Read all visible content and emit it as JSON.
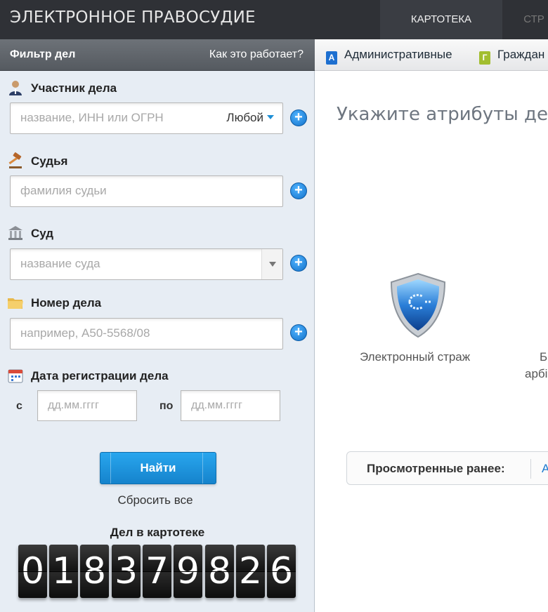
{
  "header": {
    "brand": "ЭЛЕКТРОННОЕ ПРАВОСУДИЕ",
    "tabs": [
      {
        "label": "КАРТОТЕКА",
        "active": true
      },
      {
        "label": "СТР"
      }
    ]
  },
  "filter": {
    "title": "Фильтр дел",
    "how_it_works": "Как это работает?",
    "participant": {
      "label": "Участник дела",
      "placeholder": "название, ИНН или ОГРН",
      "mode": "Любой"
    },
    "judge": {
      "label": "Судья",
      "placeholder": "фамилия судьи"
    },
    "court": {
      "label": "Суд",
      "placeholder": "название суда"
    },
    "case_number": {
      "label": "Номер дела",
      "placeholder": "например, А50-5568/08"
    },
    "date": {
      "label": "Дата регистрации дела",
      "from_label": "с",
      "from_placeholder": "дд.мм.гггг",
      "to_label": "по",
      "to_placeholder": "дд.мм.гггг"
    },
    "find_button": "Найти",
    "reset_link": "Сбросить все",
    "counter_title": "Дел в картотеке",
    "counter_digits": [
      "0",
      "1",
      "8",
      "3",
      "7",
      "9",
      "8",
      "2",
      "6"
    ]
  },
  "categories": [
    {
      "icon": "А",
      "label": "Административные"
    },
    {
      "icon": "Г",
      "label": "Граждан"
    }
  ],
  "main": {
    "title": "Укажите атрибуты дела",
    "guard_label": "Электронный страж",
    "partial_line1": "Б",
    "partial_line2": "арбі",
    "viewed_label": "Просмотренные ранее:",
    "viewed_partial": "А"
  },
  "colors": {
    "header_bg": "#2f3136",
    "sidebar_bg": "#e7edf4",
    "accent": "#1583cc"
  }
}
